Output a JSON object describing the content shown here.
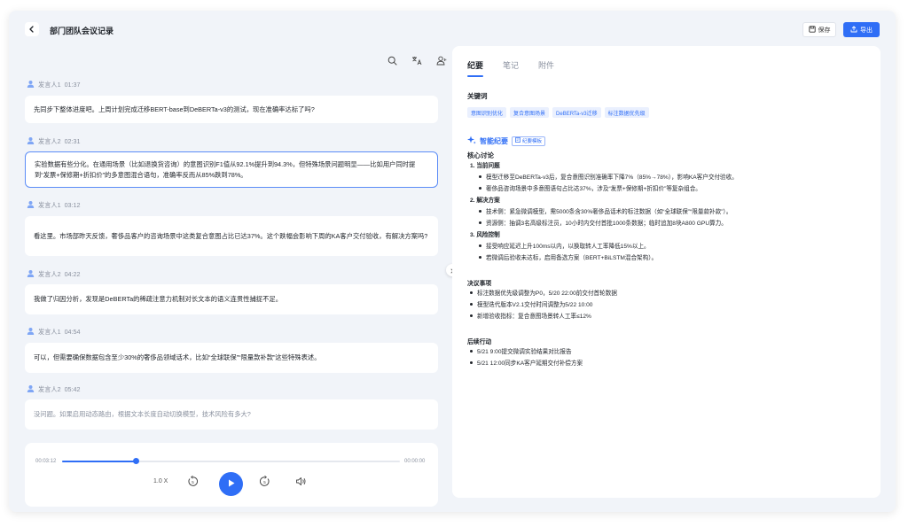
{
  "header": {
    "title": "部门团队会议记录",
    "save_label": "保存",
    "export_label": "导出"
  },
  "transcript": [
    {
      "speaker": "发言人1",
      "time": "01:37",
      "text": "先同步下整体进度吧。上周计划完成迁移BERT-base到DeBERTa-v3的测试，现在准确率达标了吗?"
    },
    {
      "speaker": "发言人2",
      "time": "02:31",
      "text": "实验数据有些分化。在通用场景（比如退换货咨询）的意图识别F1值从92.1%提升到94.3%，但特殊场景问题明显——比如用户同时提到“发票+保修期+折扣价”的多意图混合语句，准确率反而从85%跌到78%。"
    },
    {
      "speaker": "发言人1",
      "time": "03:12",
      "text": "看这里。市场部昨天反馈，奢侈品客户的咨询场景中这类复合意图占比已达37%。这个跌幅会影响下周的KA客户交付验收，有解决方案吗?"
    },
    {
      "speaker": "发言人2",
      "time": "04:22",
      "text": "我做了归因分析，发现是DeBERTa的稀疏注意力机制对长文本的语义连贯性捕捉不足。"
    },
    {
      "speaker": "发言人1",
      "time": "04:54",
      "text": "可以，但需要确保数据包含至少30%的奢侈品领域话术，比如“全球联保”“限量款补款”这些特殊表述。"
    },
    {
      "speaker": "发言人2",
      "time": "05:42",
      "text": "没问题。如果启用动态路由，根据文本长度自动切换模型，技术风险有多大?"
    }
  ],
  "player": {
    "current_time": "00:03:12",
    "total_time": "00:00:00",
    "progress": 0.22,
    "speed": "1.0 X"
  },
  "tabs": [
    "纪要",
    "笔记",
    "附件"
  ],
  "keywords": {
    "title": "关键词",
    "items": [
      "意图识别优化",
      "复合意图场景",
      "DeBERTa-v3迁移",
      "标注数据优先级"
    ]
  },
  "smart_summary": {
    "title": "智能纪要",
    "button": "纪要模板"
  },
  "core": {
    "title": "核心讨论",
    "h1": "1. 当前问题",
    "b1": "模型迁移至DeBERTa-v3后，复合意图识别准确率下降7%（85%→78%），影响KA客户交付验收。",
    "b2": "奢侈品咨询场景中多意图语句占比达37%，涉及“发票+保修期+折扣价”等复杂组合。",
    "h2": "2. 解决方案",
    "b3": "技术侧：紧急微调模型，需5000条含30%奢侈品话术的标注数据（如“全球联保”“限量款补款”）。",
    "b4": "资源侧：抽调3名高级标注员，10小时内交付首批1000条数据；临时追加8块A800 GPU算力。",
    "h3": "3. 风险控制",
    "b5": "接受响应延迟上升100ms以内，以换取转人工率降低15%以上。",
    "b6": "若微调后验收未达标，启用备选方案（BERT+BiLSTM混合架构）。"
  },
  "decisions": {
    "title": "决议事项",
    "items": [
      "标注数据优先级调整为P0，5/20 22:00前交付首轮数据",
      "模型迭代版本V2.1交付时间调整为5/22 10:00",
      "新增验收指标：复合意图场景转人工率≤12%"
    ]
  },
  "followups": {
    "title": "后续行动",
    "items": [
      "5/21 9:00提交微调实验结果对比报告",
      "5/21 12:00同步KA客户延期交付补偿方案"
    ]
  },
  "colors": {
    "accent": "#2f6ef6",
    "background": "#f1f4f9"
  }
}
